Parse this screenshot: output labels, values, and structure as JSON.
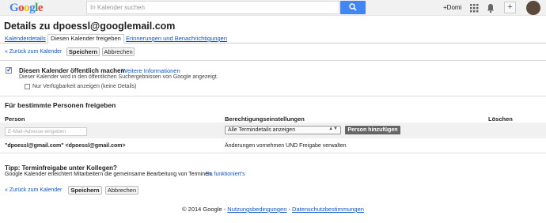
{
  "header": {
    "logo": "Google",
    "search_placeholder": "In Kalender suchen",
    "user_name": "+Domi"
  },
  "page": {
    "title": "Details zu dpoessl@googlemail.com"
  },
  "tabs": [
    {
      "label": "Kalenderdetails"
    },
    {
      "label": "Diesen Kalender freigeben"
    },
    {
      "label": "Erinnerungen und Benachrichtigungen"
    }
  ],
  "actions": {
    "back_label": "« Zurück zum Kalender",
    "save_label": "Speichern",
    "cancel_label": "Abbrechen"
  },
  "public": {
    "checkbox_label": "Diesen Kalender öffentlich machen",
    "more_info": "Weitere Informationen",
    "description": "Dieser Kalender wird in den öffentlichen Suchergebnissen von Google angezeigt.",
    "availability_label": "Nur Verfügbarkeit anzeigen (keine Details)",
    "public_checked": true,
    "availability_checked": false
  },
  "share": {
    "heading": "Für bestimmte Personen freigeben",
    "col_person": "Person",
    "col_permission": "Berechtigungseinstellungen",
    "col_delete": "Löschen",
    "email_placeholder": "E-Mail-Adresse eingeben",
    "permission_selected": "Alle Termindetails anzeigen",
    "add_button": "Person hinzufügen",
    "rows": [
      {
        "person": "\"dpoessl@gmail.com\" <dpoessl@gmail.com>",
        "permission": "Änderungen vornehmen UND Freigabe verwalten"
      }
    ]
  },
  "tip": {
    "heading": "Tipp: Terminfreigabe unter Kollegen?",
    "text": "Google Kalender erleichtert Mitarbeitern die gemeinsame Bearbeitung von Terminen.",
    "link": "So funktioniert's"
  },
  "footer": {
    "copyright": "© 2014 Google -",
    "terms": "Nutzungsbedingungen",
    "sep": "-",
    "privacy": "Datenschutzbestimmungen"
  },
  "colors": {
    "link": "#1155cc",
    "search_button": "#4285f4"
  }
}
